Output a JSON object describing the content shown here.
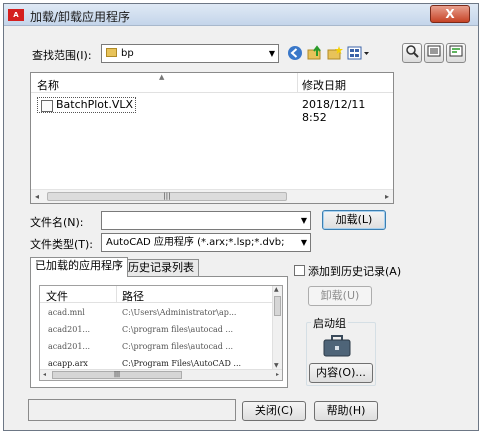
{
  "window": {
    "title": "加载/卸载应用程序",
    "app_icon_text": "A",
    "close_symbol": "X"
  },
  "look_in": {
    "label": "查找范围(I):",
    "value": "bp"
  },
  "toolbar": {
    "back_icon": "back-icon",
    "up_icon": "up-folder-icon",
    "new_folder_icon": "new-folder-icon",
    "views_icon": "views-menu-icon",
    "preview_icon": "preview-icon",
    "list_icon": "list-icon",
    "details_icon": "details-icon"
  },
  "file_list": {
    "columns": [
      "名称",
      "修改日期"
    ],
    "rows": [
      {
        "name": "BatchPlot.VLX",
        "date": "2018/12/11 8:52"
      }
    ]
  },
  "file_name": {
    "label": "文件名(N):",
    "value": ""
  },
  "file_type": {
    "label": "文件类型(T):",
    "value": "AutoCAD 应用程序 (*.arx;*.lsp;*.dvb;"
  },
  "load_button": "加载(L)",
  "tabs": {
    "loaded": "已加载的应用程序",
    "history": "历史记录列表"
  },
  "app_list": {
    "columns": [
      "文件",
      "路径"
    ],
    "rows": [
      {
        "file": "acad.mnl",
        "path": "C:\\Users\\Administrator\\ap..."
      },
      {
        "file": "acad201...",
        "path": "C:\\program files\\autocad ..."
      },
      {
        "file": "acad201...",
        "path": "C:\\program files\\autocad ..."
      },
      {
        "file": "acapp.arx",
        "path": "C:\\Program Files\\AutoCAD ..."
      }
    ]
  },
  "add_to_history": {
    "label": "添加到历史记录(A)",
    "checked": false
  },
  "unload_button": "卸载(U)",
  "startup_suite": {
    "label": "启动组",
    "contents_button": "内容(O)..."
  },
  "close_button": "关闭(C)",
  "help_button": "帮助(H)",
  "colors": {
    "accent": "#3c7fb1",
    "close": "#c64326"
  }
}
